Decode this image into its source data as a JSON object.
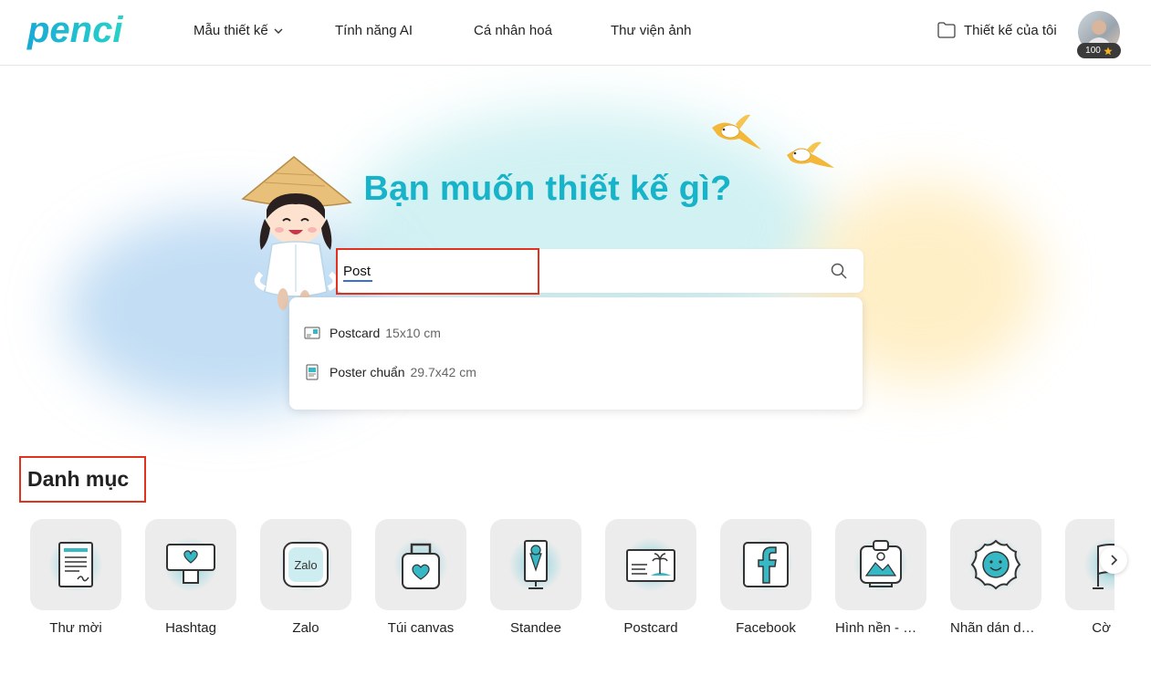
{
  "header": {
    "logo_text": "penci",
    "nav": [
      {
        "label": "Mẫu thiết kế",
        "has_dropdown": true
      },
      {
        "label": "Tính năng AI"
      },
      {
        "label": "Cá nhân hoá"
      },
      {
        "label": "Thư viện ảnh"
      }
    ],
    "my_designs": "Thiết kế của tôi",
    "credits": "100"
  },
  "hero": {
    "title": "Bạn muốn thiết kế gì?",
    "search_value": "Post",
    "suggestions": [
      {
        "name": "Postcard",
        "size": "15x10 cm",
        "icon": "postcard-icon"
      },
      {
        "name": "Poster chuẩn",
        "size": "29.7x42 cm",
        "icon": "poster-icon"
      }
    ]
  },
  "categories": {
    "title": "Danh mục",
    "items": [
      {
        "label": "Thư mời",
        "icon": "invitation-icon"
      },
      {
        "label": "Hashtag",
        "icon": "hashtag-icon"
      },
      {
        "label": "Zalo",
        "icon": "zalo-icon"
      },
      {
        "label": "Túi canvas",
        "icon": "tote-bag-icon"
      },
      {
        "label": "Standee",
        "icon": "standee-icon"
      },
      {
        "label": "Postcard",
        "icon": "postcard-icon"
      },
      {
        "label": "Facebook",
        "icon": "facebook-icon"
      },
      {
        "label": "Hình nền - W...",
        "icon": "wallpaper-icon"
      },
      {
        "label": "Nhãn dán decal",
        "icon": "sticker-icon"
      },
      {
        "label": "Cờ ph",
        "icon": "flag-icon"
      }
    ]
  },
  "colors": {
    "accent": "#17b3c9",
    "highlight": "#e0321f",
    "icon_stroke": "#333333",
    "icon_fill": "#36b9c4"
  }
}
